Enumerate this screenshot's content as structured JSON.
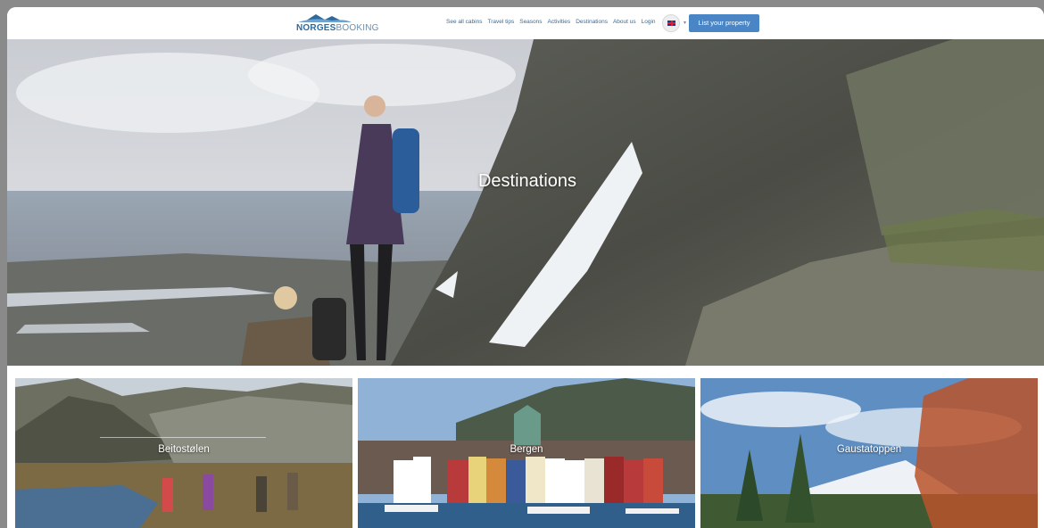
{
  "header": {
    "logo": {
      "part1": "NORGES",
      "part2": "BOOKING"
    },
    "nav": [
      "See all cabins",
      "Travel tips",
      "Seasons",
      "Activities",
      "Destinations",
      "About us",
      "Login"
    ],
    "language": {
      "icon": "uk-flag-icon",
      "caret": "▾"
    },
    "cta_label": "List your property"
  },
  "hero": {
    "title": "Destinations"
  },
  "destinations": [
    {
      "label": "Beitostølen"
    },
    {
      "label": "Bergen"
    },
    {
      "label": "Gaustatoppen"
    }
  ],
  "colors": {
    "brand": "#2f6a9c",
    "accent": "#4a86c5",
    "nav": "#3e6a93"
  }
}
